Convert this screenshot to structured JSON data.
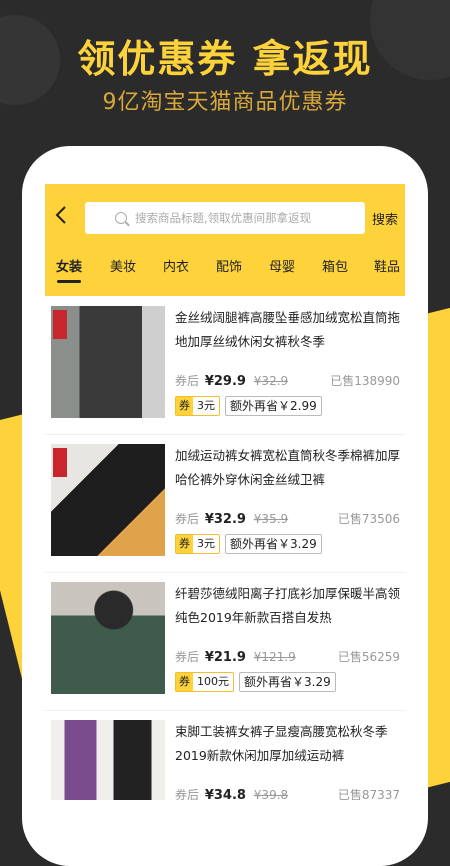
{
  "hero": {
    "title": "领优惠券 拿返现",
    "subtitle": "9亿淘宝天猫商品优惠券"
  },
  "header": {
    "back_icon": "chevron-left-icon",
    "search_placeholder": "搜索商品标题,领取优惠间那拿返现",
    "search_button": "搜索"
  },
  "tabs": [
    {
      "label": "女装",
      "active": true
    },
    {
      "label": "美妆"
    },
    {
      "label": "内衣"
    },
    {
      "label": "配饰"
    },
    {
      "label": "母婴"
    },
    {
      "label": "箱包"
    },
    {
      "label": "鞋品"
    }
  ],
  "coupon_label": "券",
  "after_coupon_label": "券后",
  "products": [
    {
      "title": "金丝绒阔腿裤高腰坠垂感加绒宽松直筒拖地加厚丝绒休闲女裤秋冬季",
      "price": "¥29.9",
      "original": "¥32.9",
      "sold": "已售138990",
      "coupon_value": "3元",
      "extra": "额外再省￥2.99",
      "thumb_colors": [
        "#8a8f8c",
        "#3a3a3a",
        "#cfcfcf"
      ]
    },
    {
      "title": "加绒运动裤女裤宽松直筒秋冬季棉裤加厚哈伦裤外穿休闲金丝绒卫裤",
      "price": "¥32.9",
      "original": "¥35.9",
      "sold": "已售73506",
      "coupon_value": "3元",
      "extra": "额外再省￥3.29",
      "thumb_colors": [
        "#e8e6e2",
        "#1e1e1e",
        "#e0a24a"
      ]
    },
    {
      "title": "纤碧莎德绒阳离子打底衫加厚保暖半高领纯色2019年新款百搭自发热",
      "price": "¥21.9",
      "original": "¥121.9",
      "sold": "已售56259",
      "coupon_value": "100元",
      "extra": "额外再省￥3.29",
      "thumb_colors": [
        "#c9c4bd",
        "#3e5b4c",
        "#2a2a2a"
      ]
    },
    {
      "title": "束脚工装裤女裤子显瘦高腰宽松秋冬季2019新款休闲加厚加绒运动裤",
      "price": "¥34.8",
      "original": "¥39.8",
      "sold": "已售87337",
      "coupon_value": "",
      "extra": "",
      "thumb_colors": [
        "#f1efec",
        "#222222",
        "#7b4c8d"
      ]
    }
  ]
}
